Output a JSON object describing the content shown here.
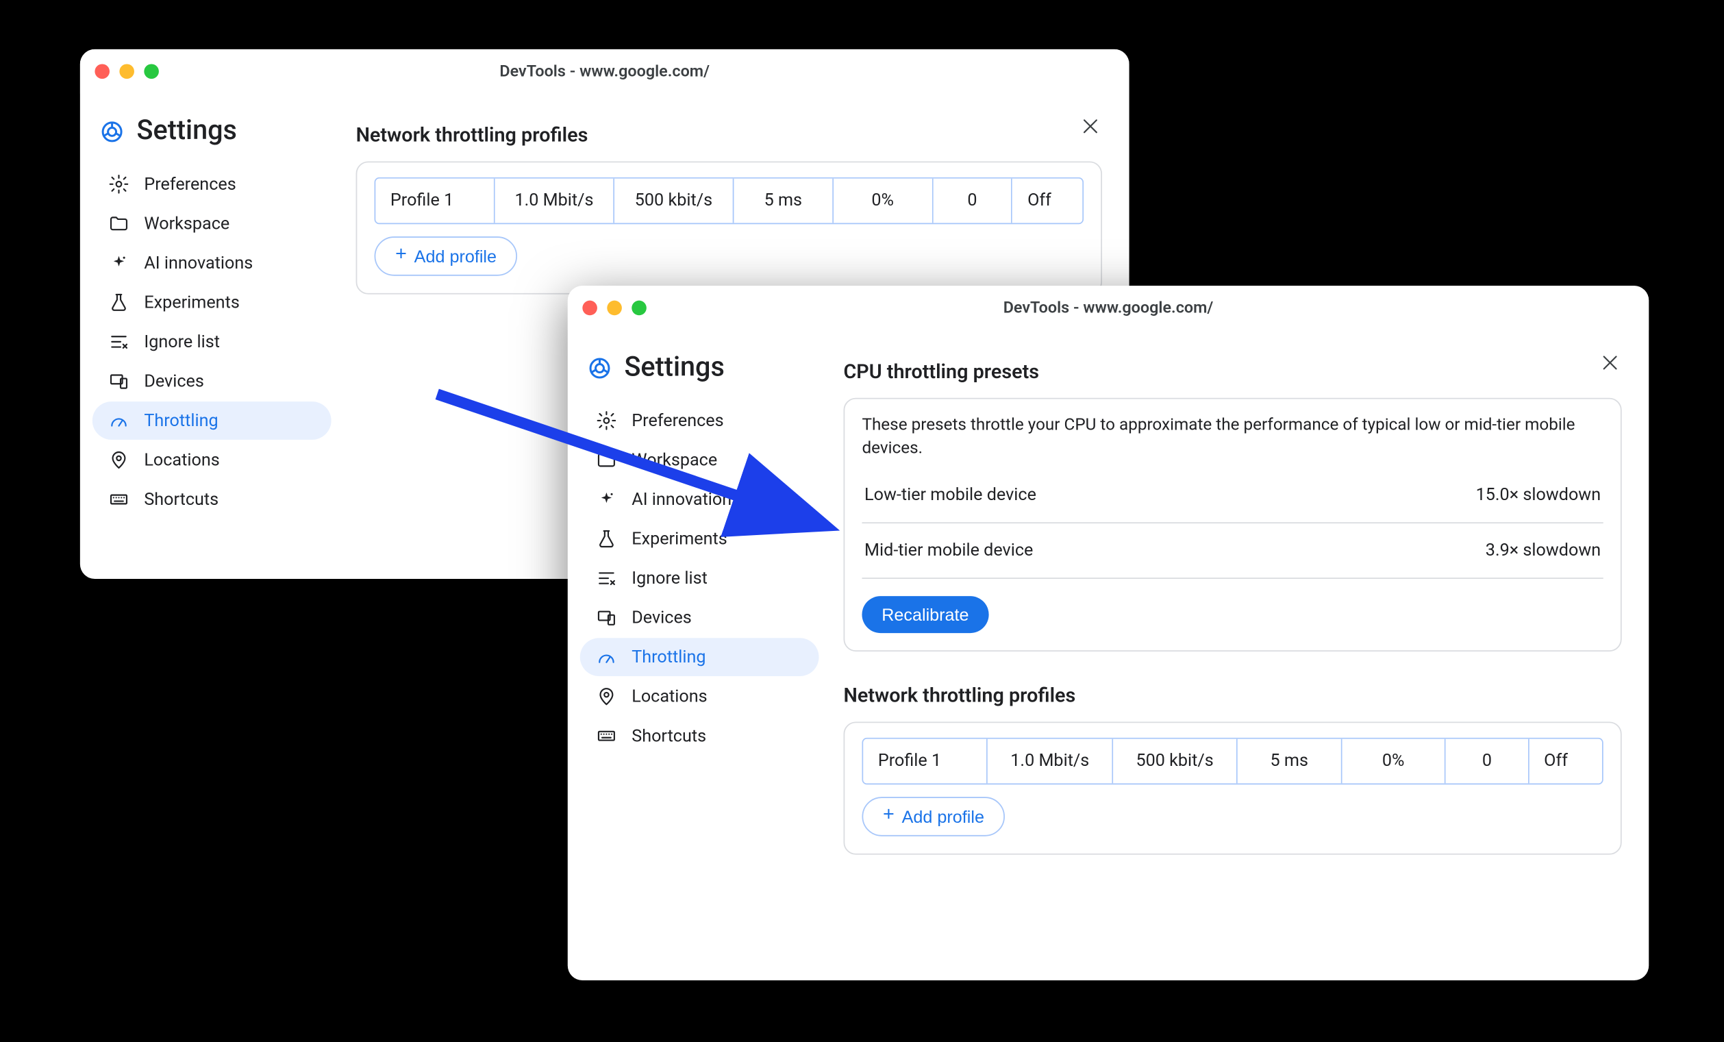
{
  "windows": {
    "win1": {
      "title": "DevTools - www.google.com/"
    },
    "win2": {
      "title": "DevTools - www.google.com/"
    }
  },
  "settings_label": "Settings",
  "sidebar": {
    "items": [
      {
        "id": "preferences",
        "label": "Preferences"
      },
      {
        "id": "workspace",
        "label": "Workspace"
      },
      {
        "id": "ai",
        "label": "AI innovations"
      },
      {
        "id": "experiments",
        "label": "Experiments"
      },
      {
        "id": "ignore",
        "label": "Ignore list"
      },
      {
        "id": "devices",
        "label": "Devices"
      },
      {
        "id": "throttling",
        "label": "Throttling"
      },
      {
        "id": "locations",
        "label": "Locations"
      },
      {
        "id": "shortcuts",
        "label": "Shortcuts"
      }
    ],
    "active": "throttling"
  },
  "cpu_section": {
    "heading": "CPU throttling presets",
    "description": "These presets throttle your CPU to approximate the performance of typical low or mid-tier mobile devices.",
    "presets": [
      {
        "name": "Low-tier mobile device",
        "value": "15.0× slowdown"
      },
      {
        "name": "Mid-tier mobile device",
        "value": "3.9× slowdown"
      }
    ],
    "recalibrate_label": "Recalibrate"
  },
  "network_section": {
    "heading": "Network throttling profiles",
    "profile": {
      "name": "Profile 1",
      "download": "1.0 Mbit/s",
      "upload": "500 kbit/s",
      "latency": "5 ms",
      "loss": "0%",
      "queue": "0",
      "state": "Off"
    },
    "add_label": "Add profile"
  }
}
